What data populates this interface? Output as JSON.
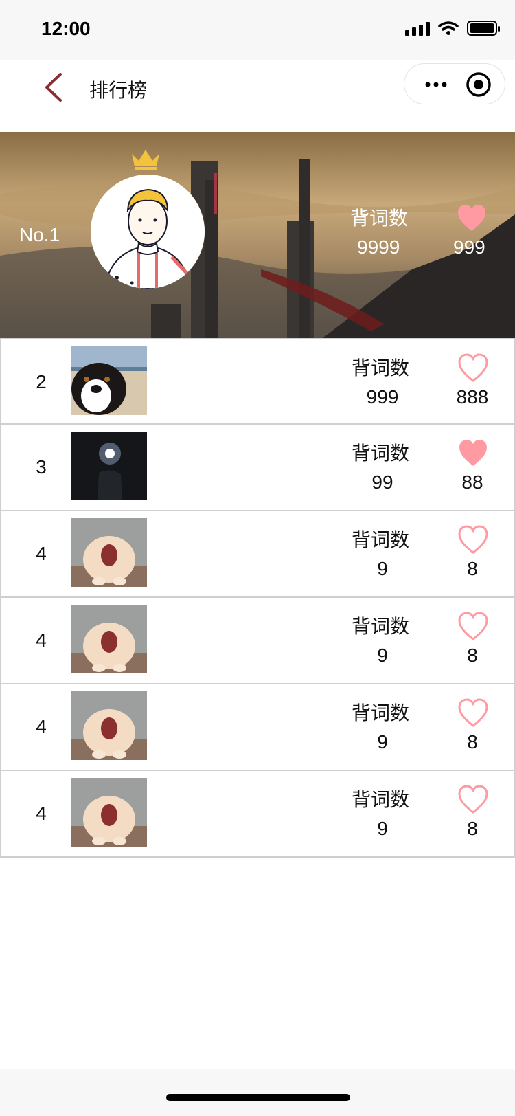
{
  "status_bar": {
    "time": "12:00"
  },
  "nav": {
    "title": "排行榜",
    "back_icon": "chevron-left-icon",
    "more_icon": "more-dots-icon",
    "record_icon": "target-icon"
  },
  "colors": {
    "accent_back": "#8b2e34",
    "heart": "#ff9aa2",
    "status_bg": "#f7f7f7"
  },
  "top_rank": {
    "rank": "No.1",
    "label": "背词数",
    "count": "9999",
    "likes": "999",
    "liked": true,
    "crown_icon": "crown-icon"
  },
  "list": [
    {
      "rank": "2",
      "label": "背词数",
      "count": "999",
      "likes": "888",
      "liked": false,
      "photo": "dog"
    },
    {
      "rank": "3",
      "label": "背词数",
      "count": "99",
      "likes": "88",
      "liked": true,
      "photo": "night-light"
    },
    {
      "rank": "4",
      "label": "背词数",
      "count": "9",
      "likes": "8",
      "liked": false,
      "photo": "cat"
    },
    {
      "rank": "4",
      "label": "背词数",
      "count": "9",
      "likes": "8",
      "liked": false,
      "photo": "cat"
    },
    {
      "rank": "4",
      "label": "背词数",
      "count": "9",
      "likes": "8",
      "liked": false,
      "photo": "cat"
    },
    {
      "rank": "4",
      "label": "背词数",
      "count": "9",
      "likes": "8",
      "liked": false,
      "photo": "cat"
    }
  ]
}
